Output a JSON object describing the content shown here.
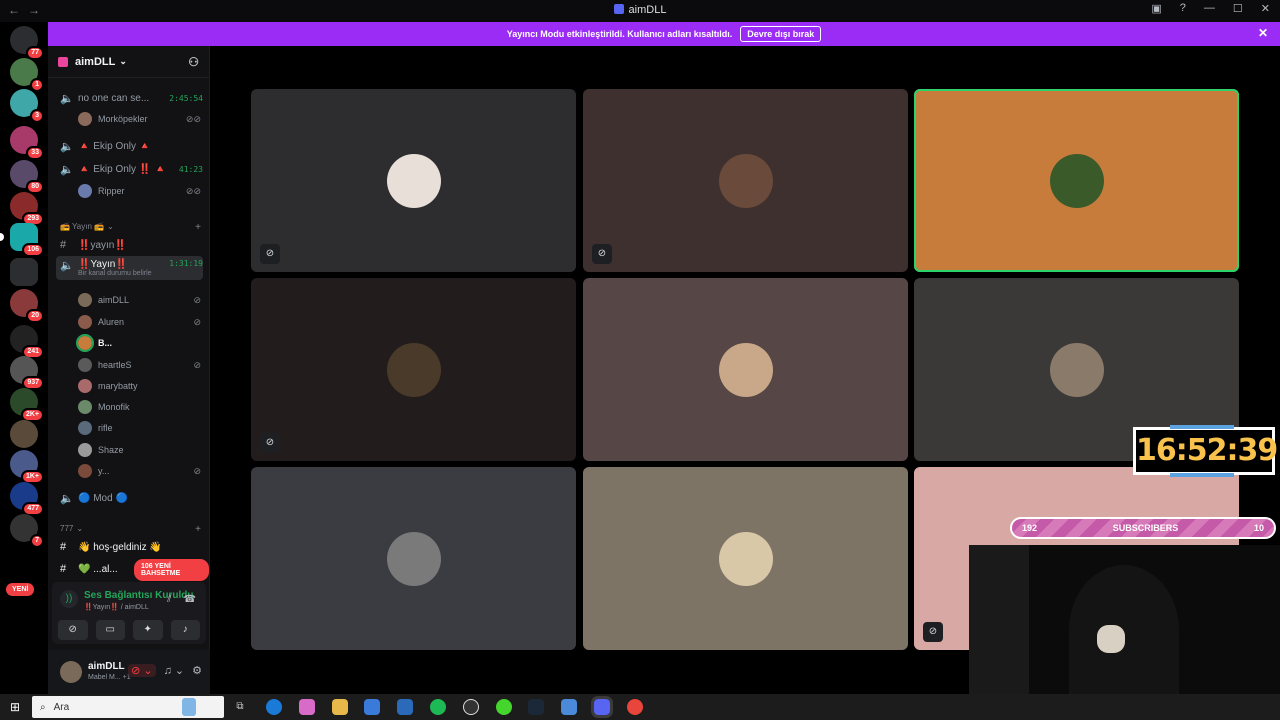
{
  "window": {
    "title": "aimDLL",
    "nav_back": "←",
    "nav_forward": "→"
  },
  "banner": {
    "message": "Yayıncı Modu etkinleştirildi. Kullanıcı adları kısaltıldı.",
    "button": "Devre dışı bırak"
  },
  "servers": [
    {
      "badge": "77"
    },
    {
      "badge": "1"
    },
    {
      "badge": "3"
    },
    {
      "badge": "33"
    },
    {
      "badge": "80"
    },
    {
      "badge": "293"
    },
    {
      "badge": "106"
    },
    {
      "badge": ""
    },
    {
      "badge": "20"
    },
    {
      "badge": "241"
    },
    {
      "badge": "937"
    },
    {
      "badge": "2K+"
    },
    {
      "badge": ""
    },
    {
      "badge": "1K+"
    },
    {
      "badge": "477"
    },
    {
      "badge": "7"
    }
  ],
  "servers_new_label": "YENİ",
  "sidebar": {
    "server_name": "aimDLL",
    "channels": {
      "c1": {
        "name": "no one can se...",
        "time": "2:45:54"
      },
      "c1_member": "Morköpekler",
      "c2": {
        "name": "🔺 Ekip Only 🔺"
      },
      "c3": {
        "name": "🔺 Ekip Only ‼️ 🔺",
        "time": "41:23"
      },
      "c3_member": "Ripper",
      "cat_yayin": "📻 Yayın 📻",
      "text_yayin": "‼️yayın‼️",
      "voice_yayin": {
        "name": "‼️Yayın‼️",
        "time": "1:31:19",
        "status": "Bir kanal durumu belirle"
      },
      "members": [
        "aimDLL",
        "Aluren",
        "B...",
        "heartleS",
        "marybatty",
        "Monofik",
        "rifle",
        "Shaze",
        "y..."
      ],
      "mod": "🔵 Mod 🔵",
      "cat_777": "777",
      "hos": "👋 hoş-geldiniz 👋",
      "last": "💚 ...al...",
      "mention_badge": "106 YENİ BAHSETME"
    }
  },
  "voice_panel": {
    "status": "Ses Bağlantısı Kuruldu",
    "channel": "‼️Yayın‼️ / aimDLL"
  },
  "user": {
    "name": "aimDLL",
    "status": "Mabel M... +1"
  },
  "overlay": {
    "clock": "16:52:39",
    "subs_left": "192",
    "subs_label": "SUBSCRIBERS",
    "subs_right": "10"
  },
  "taskbar": {
    "search_placeholder": "Ara"
  },
  "colors": {
    "banner": "#9b2cf5",
    "speaking": "#2ad46a",
    "connected": "#23a55a",
    "badge": "#f23f43"
  }
}
